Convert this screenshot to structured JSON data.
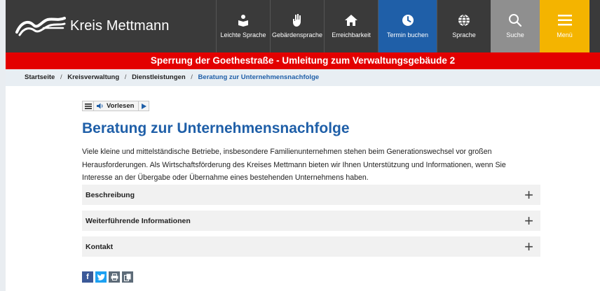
{
  "header": {
    "logo_text": "Kreis Mettmann",
    "nav": [
      {
        "label": "Leichte Sprache",
        "icon": "reader-icon"
      },
      {
        "label": "Gebärdensprache",
        "icon": "sign-language-icon"
      },
      {
        "label": "Erreichbarkeit",
        "icon": "home-icon"
      },
      {
        "label": "Termin buchen",
        "icon": "clock-icon"
      },
      {
        "label": "Sprache",
        "icon": "globe-icon"
      },
      {
        "label": "Suche",
        "icon": "search-icon"
      },
      {
        "label": "Menü",
        "icon": "hamburger-icon"
      }
    ]
  },
  "alert": "Sperrung der Goethestraße - Umleitung zum Verwaltungsgebäude 2",
  "breadcrumb": {
    "items": [
      "Startseite",
      "Kreisverwaltung",
      "Dienstleistungen"
    ],
    "current": "Beratung zur Unternehmensnachfolge",
    "separator": "/"
  },
  "readbar": {
    "label": "Vorlesen"
  },
  "main": {
    "title": "Beratung zur Unternehmensnachfolge",
    "intro": "Viele kleine und mittelständische Betriebe, insbesondere Familienunternehmen stehen beim Generationswechsel vor großen Herausforderungen. Als Wirtschaftsförderung des Kreises Mettmann bieten wir Ihnen Unterstützung und Informationen, wenn Sie Interesse an der Übergabe oder Übernahme eines bestehenden Unternehmens haben.",
    "accordions": [
      {
        "label": "Beschreibung",
        "toggle": "+"
      },
      {
        "label": "Weiterführende Informationen",
        "toggle": "+"
      },
      {
        "label": "Kontakt",
        "toggle": "+"
      }
    ]
  },
  "share": {
    "facebook": "f",
    "icons": [
      "facebook-icon",
      "twitter-icon",
      "print-icon",
      "copy-icon"
    ]
  },
  "colors": {
    "header_bg": "#3a3a3a",
    "accent_blue": "#1f5fa8",
    "alert_red": "#e30000",
    "menu_yellow": "#f4b400",
    "search_grey": "#8f8f8f"
  }
}
